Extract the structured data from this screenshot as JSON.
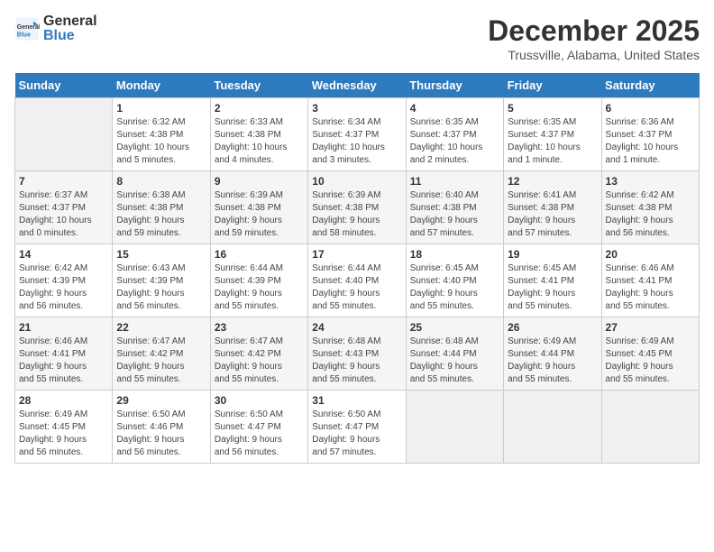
{
  "header": {
    "logo_general": "General",
    "logo_blue": "Blue",
    "title": "December 2025",
    "subtitle": "Trussville, Alabama, United States"
  },
  "calendar": {
    "days_of_week": [
      "Sunday",
      "Monday",
      "Tuesday",
      "Wednesday",
      "Thursday",
      "Friday",
      "Saturday"
    ],
    "weeks": [
      [
        {
          "day": "",
          "info": ""
        },
        {
          "day": "1",
          "info": "Sunrise: 6:32 AM\nSunset: 4:38 PM\nDaylight: 10 hours\nand 5 minutes."
        },
        {
          "day": "2",
          "info": "Sunrise: 6:33 AM\nSunset: 4:38 PM\nDaylight: 10 hours\nand 4 minutes."
        },
        {
          "day": "3",
          "info": "Sunrise: 6:34 AM\nSunset: 4:37 PM\nDaylight: 10 hours\nand 3 minutes."
        },
        {
          "day": "4",
          "info": "Sunrise: 6:35 AM\nSunset: 4:37 PM\nDaylight: 10 hours\nand 2 minutes."
        },
        {
          "day": "5",
          "info": "Sunrise: 6:35 AM\nSunset: 4:37 PM\nDaylight: 10 hours\nand 1 minute."
        },
        {
          "day": "6",
          "info": "Sunrise: 6:36 AM\nSunset: 4:37 PM\nDaylight: 10 hours\nand 1 minute."
        }
      ],
      [
        {
          "day": "7",
          "info": "Sunrise: 6:37 AM\nSunset: 4:37 PM\nDaylight: 10 hours\nand 0 minutes."
        },
        {
          "day": "8",
          "info": "Sunrise: 6:38 AM\nSunset: 4:38 PM\nDaylight: 9 hours\nand 59 minutes."
        },
        {
          "day": "9",
          "info": "Sunrise: 6:39 AM\nSunset: 4:38 PM\nDaylight: 9 hours\nand 59 minutes."
        },
        {
          "day": "10",
          "info": "Sunrise: 6:39 AM\nSunset: 4:38 PM\nDaylight: 9 hours\nand 58 minutes."
        },
        {
          "day": "11",
          "info": "Sunrise: 6:40 AM\nSunset: 4:38 PM\nDaylight: 9 hours\nand 57 minutes."
        },
        {
          "day": "12",
          "info": "Sunrise: 6:41 AM\nSunset: 4:38 PM\nDaylight: 9 hours\nand 57 minutes."
        },
        {
          "day": "13",
          "info": "Sunrise: 6:42 AM\nSunset: 4:38 PM\nDaylight: 9 hours\nand 56 minutes."
        }
      ],
      [
        {
          "day": "14",
          "info": "Sunrise: 6:42 AM\nSunset: 4:39 PM\nDaylight: 9 hours\nand 56 minutes."
        },
        {
          "day": "15",
          "info": "Sunrise: 6:43 AM\nSunset: 4:39 PM\nDaylight: 9 hours\nand 56 minutes."
        },
        {
          "day": "16",
          "info": "Sunrise: 6:44 AM\nSunset: 4:39 PM\nDaylight: 9 hours\nand 55 minutes."
        },
        {
          "day": "17",
          "info": "Sunrise: 6:44 AM\nSunset: 4:40 PM\nDaylight: 9 hours\nand 55 minutes."
        },
        {
          "day": "18",
          "info": "Sunrise: 6:45 AM\nSunset: 4:40 PM\nDaylight: 9 hours\nand 55 minutes."
        },
        {
          "day": "19",
          "info": "Sunrise: 6:45 AM\nSunset: 4:41 PM\nDaylight: 9 hours\nand 55 minutes."
        },
        {
          "day": "20",
          "info": "Sunrise: 6:46 AM\nSunset: 4:41 PM\nDaylight: 9 hours\nand 55 minutes."
        }
      ],
      [
        {
          "day": "21",
          "info": "Sunrise: 6:46 AM\nSunset: 4:41 PM\nDaylight: 9 hours\nand 55 minutes."
        },
        {
          "day": "22",
          "info": "Sunrise: 6:47 AM\nSunset: 4:42 PM\nDaylight: 9 hours\nand 55 minutes."
        },
        {
          "day": "23",
          "info": "Sunrise: 6:47 AM\nSunset: 4:42 PM\nDaylight: 9 hours\nand 55 minutes."
        },
        {
          "day": "24",
          "info": "Sunrise: 6:48 AM\nSunset: 4:43 PM\nDaylight: 9 hours\nand 55 minutes."
        },
        {
          "day": "25",
          "info": "Sunrise: 6:48 AM\nSunset: 4:44 PM\nDaylight: 9 hours\nand 55 minutes."
        },
        {
          "day": "26",
          "info": "Sunrise: 6:49 AM\nSunset: 4:44 PM\nDaylight: 9 hours\nand 55 minutes."
        },
        {
          "day": "27",
          "info": "Sunrise: 6:49 AM\nSunset: 4:45 PM\nDaylight: 9 hours\nand 55 minutes."
        }
      ],
      [
        {
          "day": "28",
          "info": "Sunrise: 6:49 AM\nSunset: 4:45 PM\nDaylight: 9 hours\nand 56 minutes."
        },
        {
          "day": "29",
          "info": "Sunrise: 6:50 AM\nSunset: 4:46 PM\nDaylight: 9 hours\nand 56 minutes."
        },
        {
          "day": "30",
          "info": "Sunrise: 6:50 AM\nSunset: 4:47 PM\nDaylight: 9 hours\nand 56 minutes."
        },
        {
          "day": "31",
          "info": "Sunrise: 6:50 AM\nSunset: 4:47 PM\nDaylight: 9 hours\nand 57 minutes."
        },
        {
          "day": "",
          "info": ""
        },
        {
          "day": "",
          "info": ""
        },
        {
          "day": "",
          "info": ""
        }
      ]
    ]
  }
}
